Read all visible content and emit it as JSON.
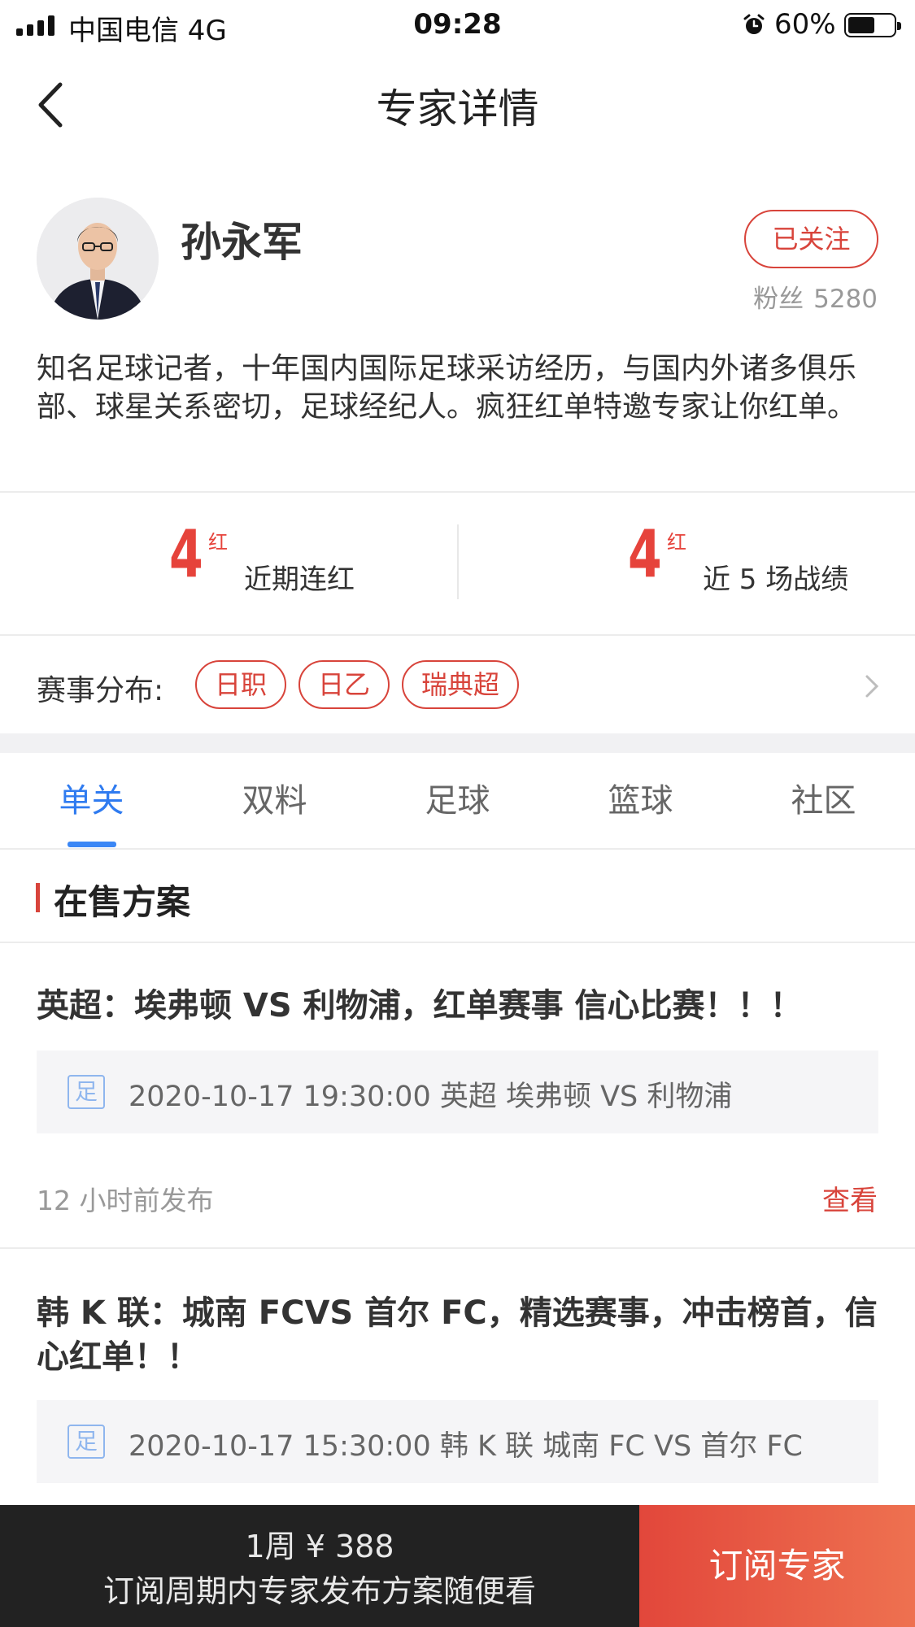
{
  "status_bar": {
    "carrier": "中国电信   4G",
    "time": "09:28",
    "battery_percent": "60%",
    "signal_bars": 4,
    "battery_level": 0.6
  },
  "nav": {
    "title": "专家详情",
    "back_icon": "chevron-left-icon"
  },
  "expert": {
    "name": "孙永军",
    "follow_label": "已关注",
    "fans_label": "粉丝",
    "fans_count": "5280",
    "bio": "知名足球记者，十年国内国际足球采访经历，与国内外诸多俱乐部、球星关系密切，足球经纪人。疯狂红单特邀专家让你红单。"
  },
  "stats": [
    {
      "value": "4",
      "unit": "红",
      "label": "近期连红"
    },
    {
      "value": "4",
      "unit": "红",
      "label": "近 5 场战绩"
    }
  ],
  "league": {
    "label": "赛事分布:",
    "chips": [
      "日职",
      "日乙",
      "瑞典超"
    ]
  },
  "tabs": {
    "active": 0,
    "items": [
      "单关",
      "双料",
      "足球",
      "篮球",
      "社区"
    ]
  },
  "section": {
    "title": "在售方案"
  },
  "plans": [
    {
      "title": "英超：埃弗顿 VS 利物浦，红单赛事 信心比赛！！！",
      "sport_tag": "足",
      "match": "2020-10-17 19:30:00 英超 埃弗顿 VS 利物浦",
      "posted": "12 小时前发布",
      "action": "查看"
    },
    {
      "title": "韩 K 联：城南 FCVS 首尔 FC，精选赛事，冲击榜首，信心红单！！",
      "sport_tag": "足",
      "match": "2020-10-17 15:30:00 韩 K 联 城南 FC VS 首尔 FC"
    }
  ],
  "bottom_bar": {
    "price": "1周 ¥ 388",
    "description": "订阅周期内专家发布方案随便看",
    "subscribe_label": "订阅专家",
    "accent_color": "#e6433b"
  }
}
